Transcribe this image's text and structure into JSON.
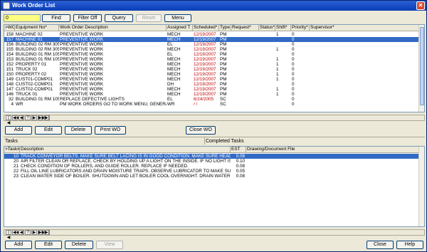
{
  "window": {
    "title": "Work Order List",
    "close_glyph": "✕"
  },
  "toolbar": {
    "search_value": "0",
    "find_label": "Find",
    "filter_off_label": "Filter Off",
    "query_label": "Query",
    "reset_label": "Reset",
    "menu_label": "Menu"
  },
  "wo_table": {
    "headers": [
      ">WO No",
      "Equipment No*",
      "Work Order Description",
      "Assigned T",
      "Scheduled*",
      "Type",
      "Request*",
      "Status*",
      "Shift*",
      "Priority*",
      "Supervisor*"
    ],
    "rows": [
      {
        "wo": "158",
        "equip": "MACHINE 02",
        "desc": "PREVENTIVE WORK",
        "assigned": "MECH",
        "sched": "12/19/2007",
        "type": "PM",
        "shift": "1",
        "priority": "0",
        "selected": false
      },
      {
        "wo": "157",
        "equip": "MACHINE 01",
        "desc": "PREVENTIVE WORK",
        "assigned": "MECH",
        "sched": "12/19/2007",
        "type": "PM",
        "shift": "",
        "priority": "0",
        "selected": true
      },
      {
        "wo": "156",
        "equip": "BUILDING 02 RM 305",
        "desc": "PREVENTIVE WORK",
        "assigned": "EL",
        "sched": "12/19/2007",
        "type": "PM",
        "shift": "",
        "priority": "0",
        "selected": false
      },
      {
        "wo": "155",
        "equip": "BUILDING 02 RM 305",
        "desc": "PREVENTIVE WORK",
        "assigned": "MECH",
        "sched": "12/19/2007",
        "type": "PM",
        "shift": "1",
        "priority": "0",
        "selected": false
      },
      {
        "wo": "154",
        "equip": "BUILDING 01 RM 105",
        "desc": "PREVENTIVE WORK",
        "assigned": "EL",
        "sched": "12/19/2007",
        "type": "PM",
        "shift": "",
        "priority": "0",
        "selected": false
      },
      {
        "wo": "153",
        "equip": "BUILDING 01 RM 105",
        "desc": "PREVENTIVE WORK",
        "assigned": "MECH",
        "sched": "12/19/2007",
        "type": "PM",
        "shift": "1",
        "priority": "0",
        "selected": false
      },
      {
        "wo": "152",
        "equip": "PROPERTY 01",
        "desc": "PREVENTIVE WORK",
        "assigned": "MECH",
        "sched": "12/19/2007",
        "type": "PM",
        "shift": "1",
        "priority": "0",
        "selected": false
      },
      {
        "wo": "151",
        "equip": "TRUCK 02",
        "desc": "PREVENTIVE WORK",
        "assigned": "MECH",
        "sched": "12/19/2007",
        "type": "PM",
        "shift": "1",
        "priority": "0",
        "selected": false
      },
      {
        "wo": "150",
        "equip": "PROPERTY 02",
        "desc": "PREVENTIVE WORK",
        "assigned": "MECH",
        "sched": "12/19/2007",
        "type": "PM",
        "shift": "1",
        "priority": "0",
        "selected": false
      },
      {
        "wo": "149",
        "equip": "CUST01-COMP01",
        "desc": "PREVENTIVE WORK",
        "assigned": "MECH",
        "sched": "12/19/2007",
        "type": "PM",
        "shift": "1",
        "priority": "0",
        "selected": false
      },
      {
        "wo": "148",
        "equip": "CUST02-COMP01",
        "desc": "PREVENTIVE WORK",
        "assigned": "DH",
        "sched": "12/19/2007",
        "type": "PM",
        "shift": "",
        "priority": "0",
        "selected": false
      },
      {
        "wo": "147",
        "equip": "CUST02-COMP01",
        "desc": "PREVENTIVE WORK",
        "assigned": "MECH",
        "sched": "12/19/2007",
        "type": "PM",
        "shift": "1",
        "priority": "0",
        "selected": false
      },
      {
        "wo": "146",
        "equip": "TRUCK 01",
        "desc": "PREVENTIVE WORK",
        "assigned": "MECH",
        "sched": "12/19/2007",
        "type": "PM",
        "shift": "1",
        "priority": "0",
        "selected": false
      },
      {
        "wo": "32",
        "equip": "BUILDING 01 RM 105",
        "desc": "REPLACE DEFECTIVE LIGHTS",
        "assigned": "EL",
        "sched": "6/24/2005",
        "type": "SC",
        "shift": "",
        "priority": "0",
        "selected": false
      },
      {
        "wo": "4",
        "equip": "WR",
        "desc": "PM WORK ORDERS GO TO WORK MENU, GENERATE PM",
        "assigned": "WR",
        "sched": "/ /",
        "type": "SC",
        "shift": "",
        "priority": "0",
        "selected": false
      }
    ]
  },
  "nav": {
    "first": "|◀",
    "prev2": "◀◀",
    "prev": "◀",
    "help": "?",
    "next": "▶",
    "next2": "▶▶",
    "last": "▶|"
  },
  "wo_actions": {
    "add_label": "Add",
    "edit_label": "Edit",
    "delete_label": "Delete",
    "print_label": "Print WO",
    "close_wo_label": "Close WO"
  },
  "tabs": {
    "tasks": "Tasks",
    "completed_tasks": "Completed Tasks"
  },
  "task_table": {
    "headers": [
      ">Task#",
      "Description",
      "EST",
      "Drawing/Document File"
    ],
    "rows": [
      {
        "task": "10",
        "desc": "TRACK CONVEYOR BELTS. MAKE SURE BELT LACING IS IN GOOD CONDITION. MAKE SURE HEAD AND T/",
        "est": "0.08",
        "selected": true
      },
      {
        "task": "20",
        "desc": "AIR FILTER CLEAN OR REPLACE. CHECK BY HOLDING UP A LIGHT ON THE INSIDE. IF NO LIGHT IS VISIBL",
        "est": "0.10",
        "selected": false
      },
      {
        "task": "21",
        "desc": "CHECK CONDITION OF ROLLERS, AND GUIDE ROLLER. REPLACE IF NEEDED.",
        "est": "0.08",
        "selected": false
      },
      {
        "task": "22",
        "desc": "FILL OIL LINE LUBRICATORS AND DRAIN MOISTURE TRAPS. OBSERVE LUBRICATOR TO MAKE SURE IT V",
        "est": "0.05",
        "selected": false
      },
      {
        "task": "23",
        "desc": "CLEAN WATER SIDE OF BOILER. SHUTDOWN AND LET BOILER COOL OVERNIGHT. DRAIN WATER SLOW",
        "est": "0.08",
        "selected": false
      }
    ]
  },
  "task_actions": {
    "add_label": "Add",
    "edit_label": "Edit",
    "delete_label": "Delete",
    "view_label": "View",
    "close_label": "Close",
    "help_label": "Help"
  }
}
